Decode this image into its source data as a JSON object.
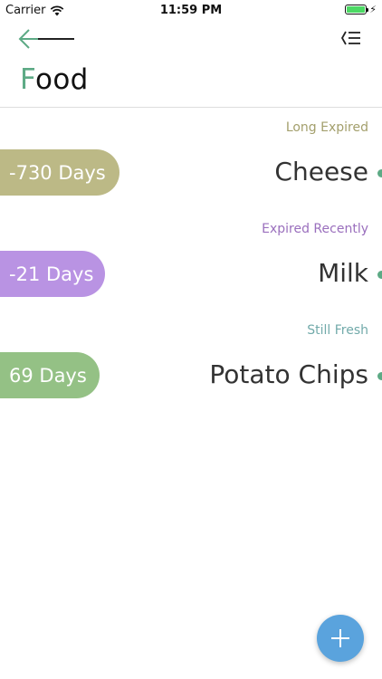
{
  "status_bar": {
    "carrier": "Carrier",
    "time": "11:59 PM",
    "battery_level": 1.0,
    "battery_color": "#4cd964"
  },
  "nav": {
    "back_icon": "arrow-left-icon",
    "menu_icon": "list-menu-icon",
    "accent_color": "#5daa85"
  },
  "title": {
    "first": "F",
    "second": "o",
    "rest": "od"
  },
  "items": [
    {
      "status": "Long Expired",
      "status_color": "#a39f6c",
      "days": "-730 Days",
      "pill_color": "#bcb986",
      "name": "Cheese"
    },
    {
      "status": "Expired Recently",
      "status_color": "#9a6fbd",
      "days": "-21 Days",
      "pill_color": "#b993e3",
      "name": "Milk"
    },
    {
      "status": "Still Fresh",
      "status_color": "#72aaaa",
      "days": "69 Days",
      "pill_color": "#94c185",
      "name": "Potato Chips"
    }
  ],
  "fab": {
    "icon": "plus-icon",
    "color": "#5aa3dd"
  }
}
